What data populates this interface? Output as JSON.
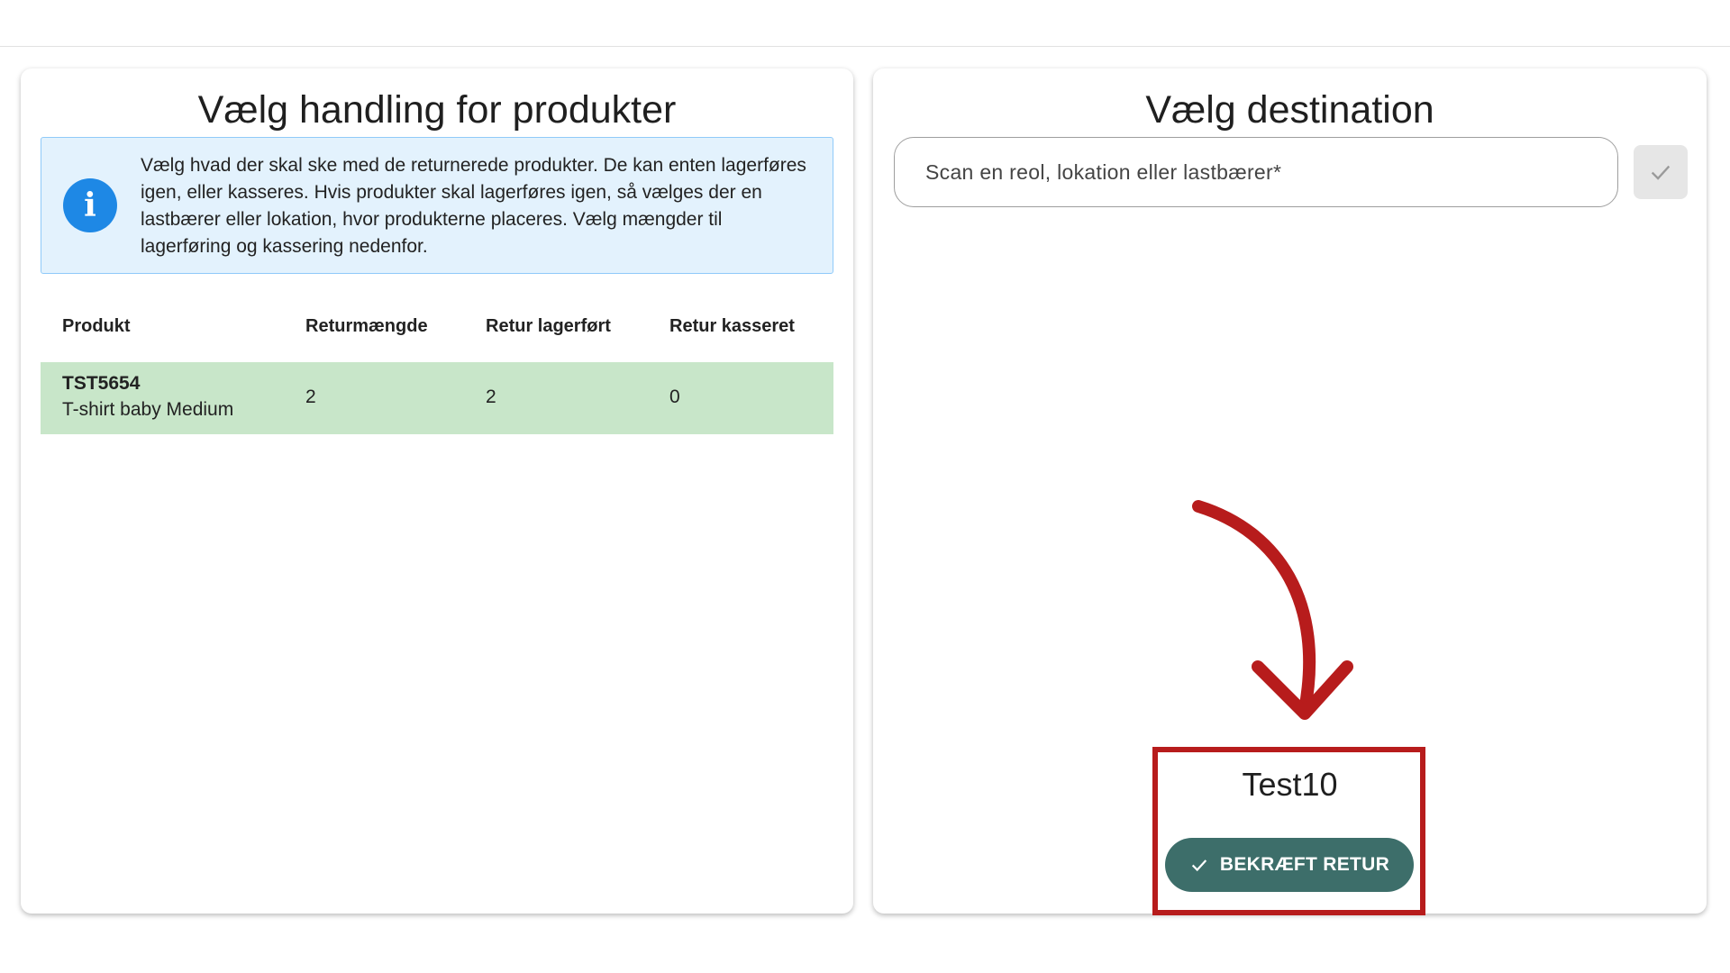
{
  "left_panel": {
    "title": "Vælg handling for produkter",
    "info_text": "Vælg hvad der skal ske med de returnerede produkter. De kan enten lagerføres igen, eller kasseres. Hvis produkter skal lagerføres igen, så vælges der en lastbærer eller lokation, hvor produkterne placeres. Vælg mængder til lagerføring og kassering nedenfor.",
    "table": {
      "headers": [
        "Produkt",
        "Returmængde",
        "Retur lagerført",
        "Retur kasseret"
      ],
      "rows": [
        {
          "sku": "TST5654",
          "name": "T-shirt baby Medium",
          "return_qty": "2",
          "stocked_qty": "2",
          "discarded_qty": "0"
        }
      ]
    }
  },
  "right_panel": {
    "title": "Vælg destination",
    "scan_placeholder": "Scan en reol, lokation eller lastbærer*",
    "destination": "Test10",
    "confirm_label": "BEKRÆFT RETUR"
  },
  "colors": {
    "info_bg": "#e3f2fd",
    "info_icon": "#1e88e5",
    "row_success": "#c8e6c9",
    "confirm_button": "#3d6e6a",
    "annotation": "#b71c1c"
  },
  "icons": {
    "info": "info-icon",
    "scan_confirm": "check-icon",
    "confirm_button": "check-icon",
    "annotation": "arrow-down-icon"
  }
}
